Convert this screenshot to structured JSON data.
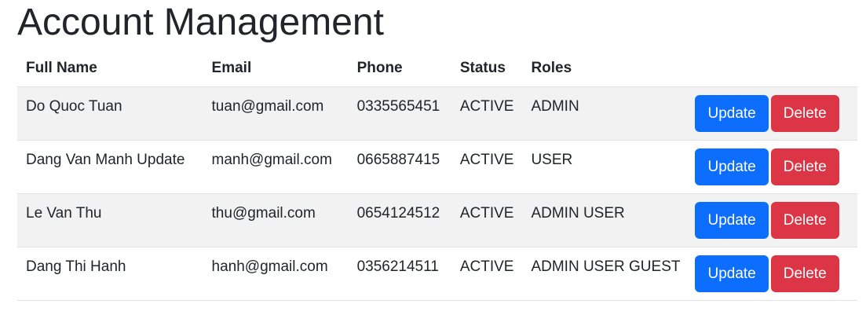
{
  "page": {
    "title": "Account Management"
  },
  "table": {
    "headers": {
      "full_name": "Full Name",
      "email": "Email",
      "phone": "Phone",
      "status": "Status",
      "roles": "Roles"
    },
    "rows": [
      {
        "full_name": "Do Quoc Tuan",
        "email": "tuan@gmail.com",
        "phone": "0335565451",
        "status": "ACTIVE",
        "roles": "ADMIN",
        "update_label": "Update",
        "delete_label": "Delete"
      },
      {
        "full_name": "Dang Van Manh Update",
        "email": "manh@gmail.com",
        "phone": "0665887415",
        "status": "ACTIVE",
        "roles": "USER",
        "update_label": "Update",
        "delete_label": "Delete"
      },
      {
        "full_name": "Le Van Thu",
        "email": "thu@gmail.com",
        "phone": "0654124512",
        "status": "ACTIVE",
        "roles": "ADMIN USER",
        "update_label": "Update",
        "delete_label": "Delete"
      },
      {
        "full_name": "Dang Thi Hanh",
        "email": "hanh@gmail.com",
        "phone": "0356214511",
        "status": "ACTIVE",
        "roles": "ADMIN USER GUEST",
        "update_label": "Update",
        "delete_label": "Delete"
      }
    ]
  },
  "colors": {
    "primary": "#0d6efd",
    "danger": "#dc3545",
    "stripe": "#f2f2f2",
    "text": "#212529"
  }
}
